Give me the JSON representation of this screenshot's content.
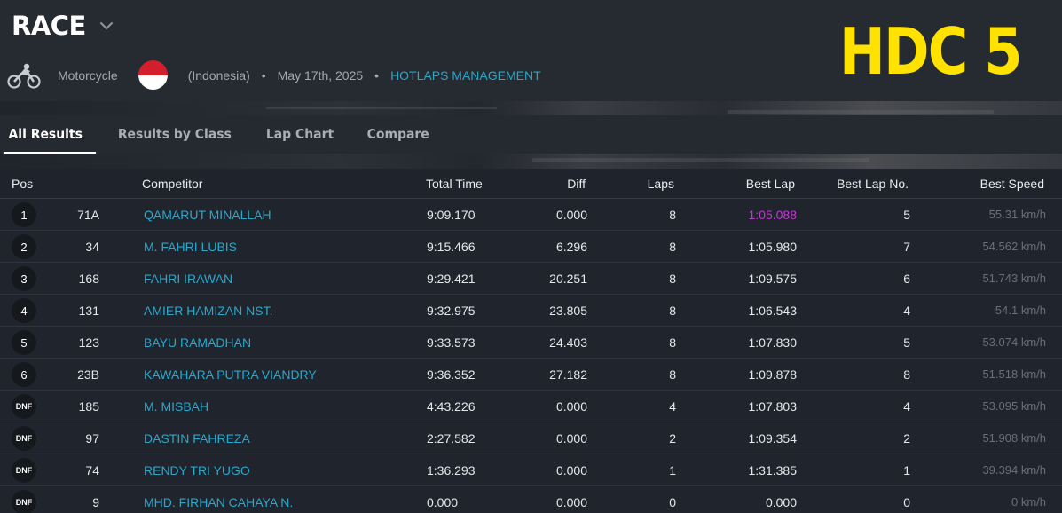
{
  "header": {
    "title": "RACE",
    "type": "Motorcycle",
    "country": "(Indonesia)",
    "date": "May 17th, 2025",
    "organizer": "HOTLAPS MANAGEMENT",
    "brand": "HDC 5",
    "separator": "•"
  },
  "tabs": [
    "All Results",
    "Results by Class",
    "Lap Chart",
    "Compare"
  ],
  "columns": {
    "pos": "Pos",
    "competitor": "Competitor",
    "total_time": "Total Time",
    "diff": "Diff",
    "laps": "Laps",
    "best_lap": "Best Lap",
    "best_lap_no": "Best Lap No.",
    "best_speed": "Best Speed"
  },
  "rows": [
    {
      "pos": "1",
      "num": "71A",
      "name": "QAMARUT MINALLAH",
      "total": "9:09.170",
      "diff": "0.000",
      "laps": "8",
      "best": "1:05.088",
      "best_no": "5",
      "speed": "55.31 km/h"
    },
    {
      "pos": "2",
      "num": "34",
      "name": "M. FAHRI LUBIS",
      "total": "9:15.466",
      "diff": "6.296",
      "laps": "8",
      "best": "1:05.980",
      "best_no": "7",
      "speed": "54.562 km/h"
    },
    {
      "pos": "3",
      "num": "168",
      "name": "FAHRI IRAWAN",
      "total": "9:29.421",
      "diff": "20.251",
      "laps": "8",
      "best": "1:09.575",
      "best_no": "6",
      "speed": "51.743 km/h"
    },
    {
      "pos": "4",
      "num": "131",
      "name": "AMIER HAMIZAN NST.",
      "total": "9:32.975",
      "diff": "23.805",
      "laps": "8",
      "best": "1:06.543",
      "best_no": "4",
      "speed": "54.1 km/h"
    },
    {
      "pos": "5",
      "num": "123",
      "name": "BAYU RAMADHAN",
      "total": "9:33.573",
      "diff": "24.403",
      "laps": "8",
      "best": "1:07.830",
      "best_no": "5",
      "speed": "53.074 km/h"
    },
    {
      "pos": "6",
      "num": "23B",
      "name": "KAWAHARA PUTRA VIANDRY",
      "total": "9:36.352",
      "diff": "27.182",
      "laps": "8",
      "best": "1:09.878",
      "best_no": "8",
      "speed": "51.518 km/h"
    },
    {
      "pos": "DNF",
      "num": "185",
      "name": "M. MISBAH",
      "total": "4:43.226",
      "diff": "0.000",
      "laps": "4",
      "best": "1:07.803",
      "best_no": "4",
      "speed": "53.095 km/h"
    },
    {
      "pos": "DNF",
      "num": "97",
      "name": "DASTIN FAHREZA",
      "total": "2:27.582",
      "diff": "0.000",
      "laps": "2",
      "best": "1:09.354",
      "best_no": "2",
      "speed": "51.908 km/h"
    },
    {
      "pos": "DNF",
      "num": "74",
      "name": "RENDY TRI YUGO",
      "total": "1:36.293",
      "diff": "0.000",
      "laps": "1",
      "best": "1:31.385",
      "best_no": "1",
      "speed": "39.394 km/h"
    },
    {
      "pos": "DNF",
      "num": "9",
      "name": "MHD. FIRHAN CAHAYA N.",
      "total": "0.000",
      "diff": "0.000",
      "laps": "0",
      "best": "0.000",
      "best_no": "0",
      "speed": "0 km/h"
    }
  ],
  "colors": {
    "background": "#1f232b",
    "link": "#2aa8cc",
    "brand": "#ffe200",
    "fastest_lap": "#c636d6",
    "flag_red": "#d31e2e"
  },
  "icons": {
    "sport": "motorcycle-icon",
    "title_toggle": "chevron-down-icon",
    "country": "indonesia-flag-icon"
  }
}
